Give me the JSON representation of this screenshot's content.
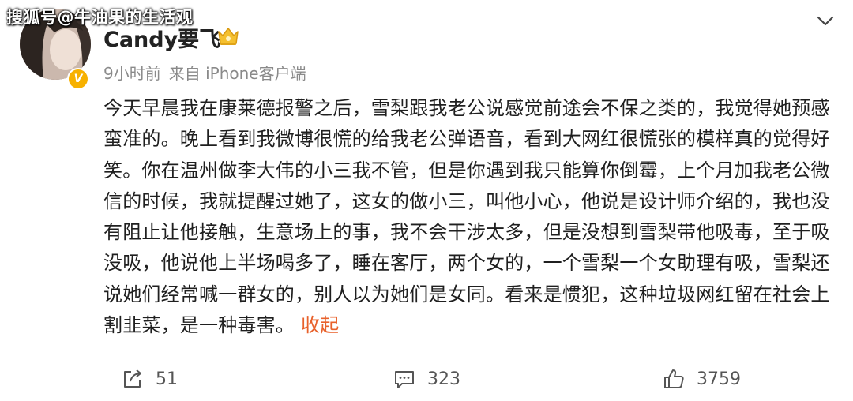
{
  "watermark": "搜狐号@牛油果的生活观",
  "post": {
    "username": "Candy要飞",
    "verified_badge": "V",
    "time": "9小时前",
    "source": "来自 iPhone客户端",
    "content": "今天早晨我在康莱德报警之后，雪梨跟我老公说感觉前途会不保之类的，我觉得她预感蛮准的。晚上看到我微博很慌的给我老公弹语音，看到大网红很慌张的模样真的觉得好笑。你在温州做李大伟的小三我不管，但是你遇到我只能算你倒霉，上个月加我老公微信的时候，我就提醒过她了，这女的做小三，叫他小心，他说是设计师介绍的，我也没有阻止让他接触，生意场上的事，我不会干涉太多，但是没想到雪梨带他吸毒，至于吸没吸，他说他上半场喝多了，睡在客厅，两个女的，一个雪梨一个女助理有吸，雪梨还说她们经常喊一群女的，别人以为她们是女同。看来是惯犯，这种垃圾网红留在社会上割韭菜，是一种毒害。",
    "collapse_label": "收起"
  },
  "actions": {
    "share_count": "51",
    "comment_count": "323",
    "like_count": "3759"
  },
  "icons": {
    "share": "share-icon",
    "comment": "comment-icon",
    "like": "thumbs-up-icon",
    "more": "chevron-down-icon",
    "member_badge": "crown-badge-icon"
  },
  "colors": {
    "collapse_link": "#e8612b",
    "badge": "#f7b100",
    "meta_text": "#8a8a8a"
  }
}
